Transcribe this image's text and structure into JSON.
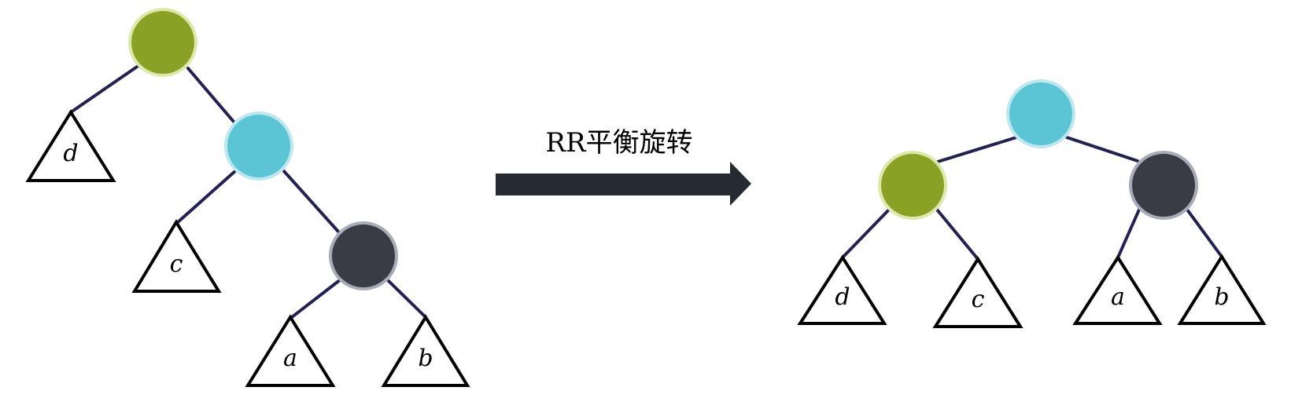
{
  "rotation": {
    "label": "RR平衡旋转",
    "arrow_color": "#252a33"
  },
  "colors": {
    "green_node": "#8aa126",
    "green_node_ring": "#dde9a8",
    "cyan_node": "#5bc5d6",
    "cyan_node_ring": "#bfe7ef",
    "dark_node": "#393c45",
    "dark_node_ring": "#a7acb8",
    "edge": "#232154",
    "subtree_outline": "#000000"
  },
  "before_tree": {
    "subtrees": {
      "d": "d",
      "c": "c",
      "a": "a",
      "b": "b"
    }
  },
  "after_tree": {
    "subtrees": {
      "d": "d",
      "c": "c",
      "a": "a",
      "b": "b"
    }
  }
}
